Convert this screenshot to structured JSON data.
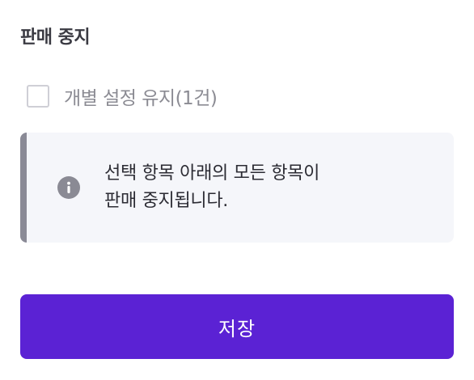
{
  "section": {
    "title": "판매 중지"
  },
  "checkbox": {
    "label": "개별 설정 유지(1건)",
    "checked": false
  },
  "notice": {
    "icon": "info-icon",
    "line1": "선택 항목 아래의 모든 항목이",
    "line2": "판매 중지됩니다."
  },
  "actions": {
    "save_label": "저장"
  },
  "colors": {
    "accent": "#5b22d4",
    "notice_background": "#f5f6fa",
    "notice_bar": "#8a8a96"
  }
}
